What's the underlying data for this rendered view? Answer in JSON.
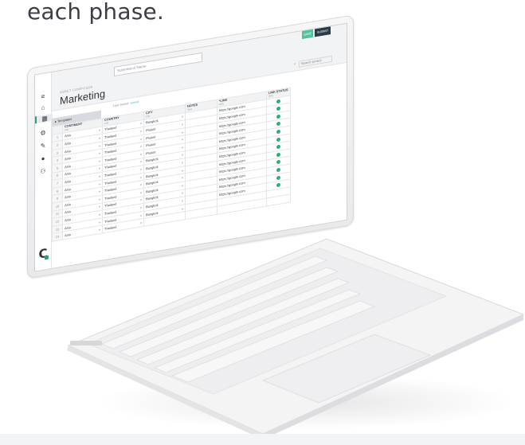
{
  "caption": "each phase.",
  "app": {
    "eyebrow": "ASSET COMPOSER",
    "section_title": "Marketing",
    "name_placeholder": "Submission Name",
    "save_label": "SAVE",
    "submit_label": "SUBMIT",
    "search_label": "Search (enter)",
    "autosave_prefix": "Last Saved:",
    "autosave_state": "Saved",
    "templates_label": "Templates"
  },
  "rail": {
    "icons": [
      "menu-icon",
      "home-icon",
      "grid-icon",
      "gear-icon",
      "wrench-icon",
      "globe-icon",
      "users-icon"
    ]
  },
  "table": {
    "columns": [
      {
        "label": "CONTINENT",
        "sub": "List"
      },
      {
        "label": "COUNTRY",
        "sub": "List"
      },
      {
        "label": "CITY",
        "sub": "List"
      },
      {
        "label": "NOTES",
        "sub": "Text"
      },
      {
        "label": "*LINK",
        "sub": "URL"
      },
      {
        "label": "LINK STATUS",
        "sub": "URL"
      }
    ],
    "rows": [
      {
        "n": "1",
        "continent": "Asia",
        "country": "Thailand",
        "city": "Bangkok",
        "link": "https://google.com"
      },
      {
        "n": "2",
        "continent": "Asia",
        "country": "Thailand",
        "city": "Phuket",
        "link": "https://google.com"
      },
      {
        "n": "3",
        "continent": "Asia",
        "country": "Thailand",
        "city": "Phuket",
        "link": "https://google.com"
      },
      {
        "n": "4",
        "continent": "Asia",
        "country": "Thailand",
        "city": "Phuket",
        "link": "https://google.com"
      },
      {
        "n": "5",
        "continent": "Asia",
        "country": "Thailand",
        "city": "Phuket",
        "link": "https://google.com"
      },
      {
        "n": "6",
        "continent": "Asia",
        "country": "Thailand",
        "city": "Bangkok",
        "link": "https://google.com"
      },
      {
        "n": "7",
        "continent": "Asia",
        "country": "Thailand",
        "city": "Bangkok",
        "link": "https://google.com"
      },
      {
        "n": "8",
        "continent": "Asia",
        "country": "Thailand",
        "city": "Bangkok",
        "link": "https://google.com"
      },
      {
        "n": "9",
        "continent": "Asia",
        "country": "Thailand",
        "city": "Bangkok",
        "link": "https://google.com"
      },
      {
        "n": "10",
        "continent": "Asia",
        "country": "Thailand",
        "city": "Bangkok",
        "link": "https://google.com"
      },
      {
        "n": "11",
        "continent": "Asia",
        "country": "Thailand",
        "city": "Bangkok",
        "link": "https://google.com"
      },
      {
        "n": "12",
        "continent": "Asia",
        "country": "Thailand",
        "city": "Bangkok",
        "link": "https://google.com"
      },
      {
        "n": "13",
        "continent": "Asia",
        "country": "Thailand",
        "city": "Bangkok",
        "link": ""
      },
      {
        "n": "14",
        "continent": "Asia",
        "country": "Thailand",
        "city": "",
        "link": ""
      }
    ]
  },
  "colors": {
    "accent": "#52c29c",
    "dark_button": "#2b3a44",
    "status_ok": "#2fae7c"
  }
}
